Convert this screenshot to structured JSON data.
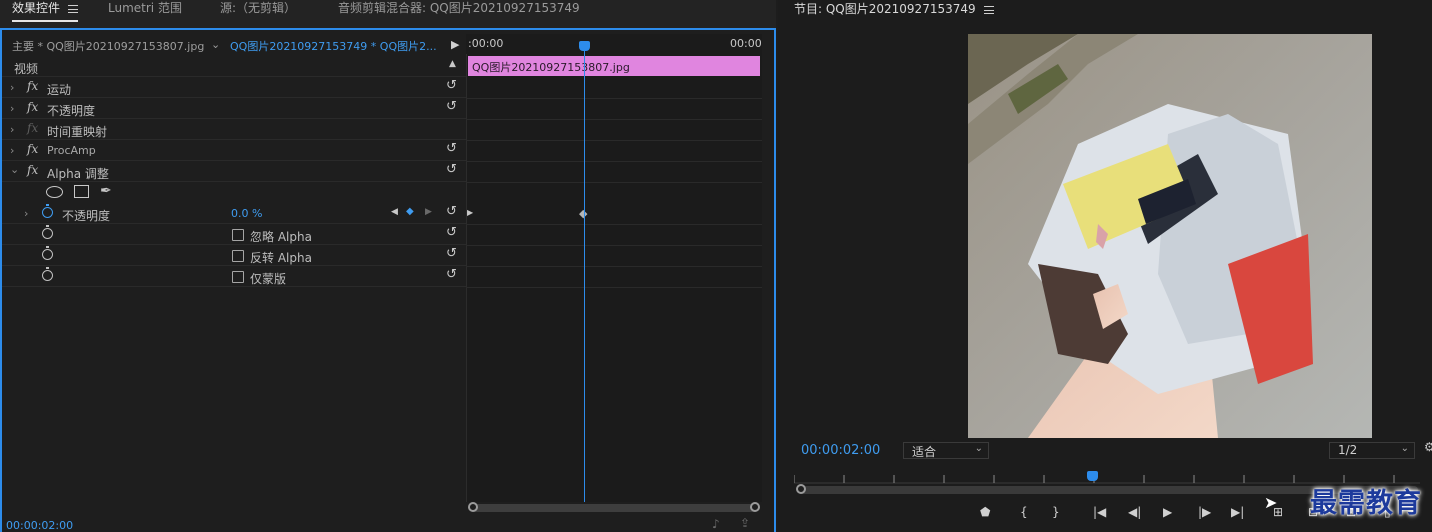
{
  "panel_tabs": [
    {
      "label": "效果控件",
      "active": true
    },
    {
      "label": "Lumetri 范围",
      "active": false
    },
    {
      "label": "源:（无剪辑）",
      "active": false
    },
    {
      "label": "音频剪辑混合器: QQ图片20210927153749",
      "active": false
    }
  ],
  "clip_tabs": {
    "master": "主要 * QQ图片20210927153807.jpg",
    "sequence": "QQ图片20210927153749 * QQ图片2..."
  },
  "timeline": {
    "start_time": ":00:00",
    "end_time": "00:00",
    "clip_name": "QQ图片20210927153807.jpg"
  },
  "section_label": "视频",
  "effects": [
    {
      "label": "运动",
      "expandable": true
    },
    {
      "label": "不透明度",
      "expandable": true
    },
    {
      "label": "时间重映射",
      "expandable": true,
      "dimmed": true
    },
    {
      "label": "ProcAmp",
      "expandable": true
    },
    {
      "label": "Alpha 调整",
      "expandable": true,
      "expanded": true
    }
  ],
  "alpha_params": {
    "opacity_label": "不透明度",
    "opacity_value": "0.0 %",
    "ignore_alpha": "忽略 Alpha",
    "invert_alpha": "反转 Alpha",
    "mask_only": "仅蒙版"
  },
  "left_timecode": "00:00:02:00",
  "program": {
    "title": "节目: QQ图片20210927153749",
    "timecode": "00:00:02:00",
    "fit_option": "适合",
    "resolution": "1/2"
  },
  "watermark": "最需教育",
  "colors": {
    "accent": "#2d8ceb",
    "clip_bar": "#e085df"
  }
}
